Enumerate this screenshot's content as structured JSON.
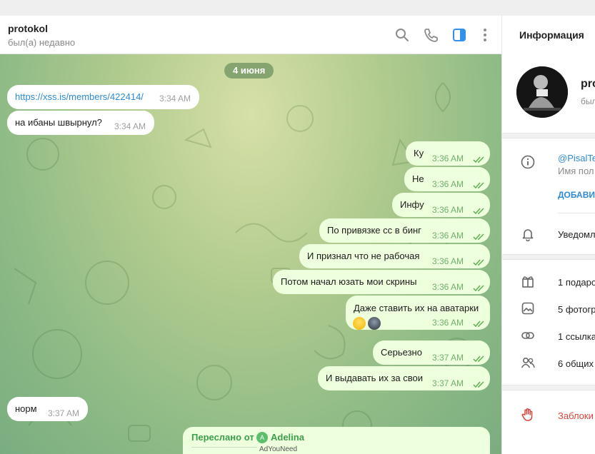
{
  "header": {
    "name": "protokol",
    "status": "был(а) недавно"
  },
  "chat": {
    "date": "4 июня",
    "messages": [
      {
        "dir": "in",
        "text": "https://xss.is/members/422414/",
        "time": "3:34 AM",
        "link": true
      },
      {
        "dir": "in",
        "text": "на ибаны швырнул?",
        "time": "3:34 AM"
      },
      {
        "dir": "out",
        "text": "Ку",
        "time": "3:36 AM"
      },
      {
        "dir": "out",
        "text": "Не",
        "time": "3:36 AM"
      },
      {
        "dir": "out",
        "text": "Инфу",
        "time": "3:36 AM"
      },
      {
        "dir": "out",
        "text": "По привязке сс в бинг",
        "time": "3:36 AM"
      },
      {
        "dir": "out",
        "text": "И признал что не рабочая",
        "time": "3:36 AM"
      },
      {
        "dir": "out",
        "text": "Потом начал юзать мои скрины",
        "time": "3:36 AM"
      },
      {
        "dir": "out",
        "text": "Даже ставить их на аватарки",
        "time": "3:36 AM",
        "emojis": [
          "grinning-face-emoji",
          "custom-sticker-emoji"
        ]
      },
      {
        "dir": "out",
        "text": "Серьезно",
        "time": "3:37 AM"
      },
      {
        "dir": "out",
        "text": "И выдавать их за свои",
        "time": "3:37 AM"
      },
      {
        "dir": "in",
        "text": "норм",
        "time": "3:37 AM"
      }
    ],
    "forwarded": {
      "label": "Переслано от",
      "avatar_letter": "A",
      "from": "Adelina",
      "preview": "AdYouNeed"
    }
  },
  "sidebar": {
    "title": "Информация",
    "profile_name": "pro",
    "profile_status": "был",
    "username": "@PisalTe",
    "username_sub": "Имя пол",
    "add_button": "ДОБАВИ",
    "notifications": "Уведомл",
    "gifts": "1 подаро",
    "photos": "5 фотогр",
    "links": "1 ссылка",
    "groups": "6 общих",
    "block": "Заблоки"
  },
  "colors": {
    "outgoing_bubble": "#eeffde",
    "incoming_bubble": "#ffffff",
    "accent_blue": "#2d8bd4",
    "forward_green": "#3aa04a",
    "danger_red": "#d9453d"
  }
}
